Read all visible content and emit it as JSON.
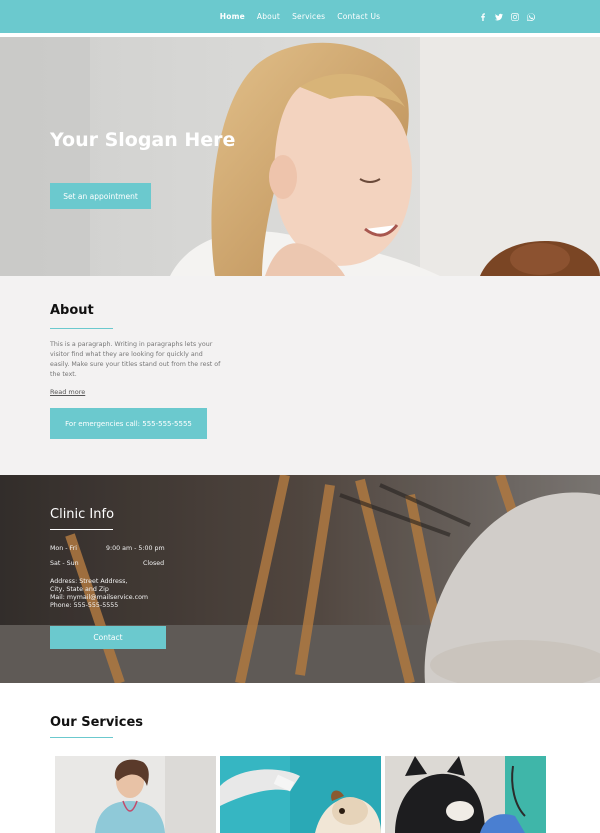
{
  "nav": {
    "links": [
      "Home",
      "About",
      "Services",
      "Contact Us"
    ],
    "active": "Home",
    "socials": [
      "facebook-icon",
      "twitter-icon",
      "instagram-icon",
      "whatsapp-icon"
    ]
  },
  "hero": {
    "title": "Your Slogan Here",
    "button": "Set an appointment"
  },
  "about": {
    "title": "About",
    "paragraph": "This is a paragraph. Writing in paragraphs lets your visitor find what they are looking for quickly and easily. Make sure your titles stand out from the rest of the text.",
    "read_more": "Read more",
    "emergency_button": "For emergencies call: 555-555-5555"
  },
  "clinic": {
    "title": "Clinic Info",
    "hours": [
      {
        "days": "Mon - Fri",
        "time": "9:00 am - 5:00 pm"
      },
      {
        "days": "Sat - Sun",
        "time": "Closed"
      }
    ],
    "address": "Address: Street Address,",
    "city": "City, State and Zip",
    "mail": "Mail: mymail@mailservice.com",
    "phone": "Phone: 555-555-5555",
    "contact_button": "Contact"
  },
  "services": {
    "title": "Our Services"
  },
  "colors": {
    "accent": "#6bc9ce",
    "about_bg": "#f3f2f2"
  }
}
